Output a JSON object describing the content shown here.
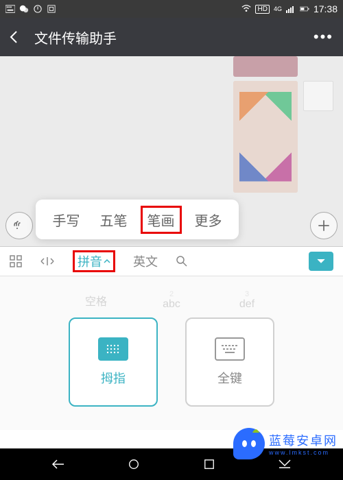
{
  "statusBar": {
    "time": "17:38",
    "network": "4G",
    "hd": "HD"
  },
  "header": {
    "title": "文件传输助手"
  },
  "inputPopup": {
    "items": [
      "手写",
      "五笔",
      "笔画",
      "更多"
    ],
    "highlightedIndex": 2
  },
  "imeToolbar": {
    "pinyin": "拼音",
    "english": "英文",
    "highlightedIndex": 0
  },
  "keyboard": {
    "fadedRow": [
      "空格",
      "abc",
      "def"
    ],
    "layouts": [
      {
        "label": "拇指",
        "selected": true
      },
      {
        "label": "全键",
        "selected": false
      }
    ]
  },
  "watermark": {
    "text": "蓝莓安卓网",
    "url": "www.lmkst.com"
  }
}
